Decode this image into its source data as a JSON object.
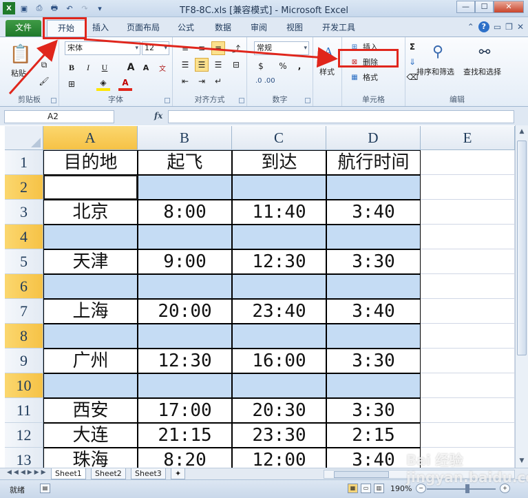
{
  "window": {
    "title": "TF8-8C.xls  [兼容模式] - Microsoft Excel",
    "controls": [
      "—",
      "☐",
      "✕"
    ]
  },
  "ribbon_tabs": [
    "文件",
    "开始",
    "插入",
    "页面布局",
    "公式",
    "数据",
    "审阅",
    "视图",
    "开发工具"
  ],
  "ribbon": {
    "clipboard": {
      "paste": "粘贴",
      "label": "剪贴板"
    },
    "font": {
      "name": "宋体",
      "size": "12",
      "bold": "B",
      "italic": "I",
      "underline": "U",
      "grow": "A",
      "shrink": "A",
      "label": "字体"
    },
    "alignment": {
      "label": "对齐方式"
    },
    "number": {
      "format": "常规",
      "currency": "$",
      "percent": "%",
      "comma": ",",
      "inc": ".0 .00",
      "label": "数字"
    },
    "styles": {
      "label": "样式"
    },
    "cells": {
      "insert": "插入",
      "delete": "删除",
      "format": "格式",
      "label": "单元格"
    },
    "editing": {
      "sort": "排序和筛选",
      "find": "查找和选择",
      "sum": "Σ",
      "label": "编辑"
    }
  },
  "formula_bar": {
    "name_box": "A2",
    "fx": "fx",
    "value": ""
  },
  "columns": [
    "A",
    "B",
    "C",
    "D",
    "E"
  ],
  "rows": [
    {
      "num": "1",
      "cells": [
        "目的地",
        "起飞",
        "到达",
        "航行时间"
      ]
    },
    {
      "num": "2",
      "cells": [
        "",
        "",
        "",
        ""
      ]
    },
    {
      "num": "3",
      "cells": [
        "北京",
        "8:00",
        "11:40",
        "3:40"
      ]
    },
    {
      "num": "4",
      "cells": [
        "",
        "",
        "",
        ""
      ]
    },
    {
      "num": "5",
      "cells": [
        "天津",
        "9:00",
        "12:30",
        "3:30"
      ]
    },
    {
      "num": "6",
      "cells": [
        "",
        "",
        "",
        ""
      ]
    },
    {
      "num": "7",
      "cells": [
        "上海",
        "20:00",
        "23:40",
        "3:40"
      ]
    },
    {
      "num": "8",
      "cells": [
        "",
        "",
        "",
        ""
      ]
    },
    {
      "num": "9",
      "cells": [
        "广州",
        "12:30",
        "16:00",
        "3:30"
      ]
    },
    {
      "num": "10",
      "cells": [
        "",
        "",
        "",
        ""
      ]
    },
    {
      "num": "11",
      "cells": [
        "西安",
        "17:00",
        "20:30",
        "3:30"
      ]
    },
    {
      "num": "12",
      "cells": [
        "大连",
        "21:15",
        "23:30",
        "2:15"
      ]
    },
    {
      "num": "13",
      "cells": [
        "珠海",
        "8:20",
        "12:00",
        "3:40"
      ]
    }
  ],
  "sheets": [
    "Sheet1",
    "Sheet2",
    "Sheet3"
  ],
  "status": {
    "ready": "就绪",
    "zoom": "190%",
    "minus": "−",
    "plus": "+"
  },
  "watermark": "Bai 经验 jingyan.baidu.com",
  "colors": {
    "selected_header": "#f6c246",
    "highlight_fill": "#c5dcf4",
    "annotation": "#e0261c"
  }
}
